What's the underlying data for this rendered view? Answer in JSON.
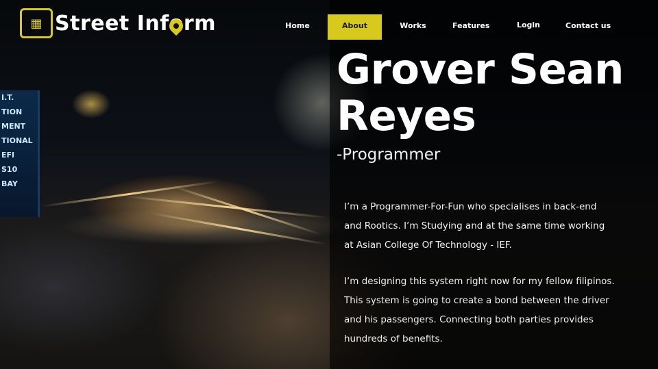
{
  "brand": {
    "name": "Street Inform",
    "accent": "#d8c91d",
    "logo_icon": "map-icon",
    "pin_icon": "location-pin-icon"
  },
  "nav": {
    "items": [
      {
        "label": "Home",
        "active": false
      },
      {
        "label": "About",
        "active": true
      },
      {
        "label": "Works",
        "active": false
      },
      {
        "label": "Features",
        "active": false
      },
      {
        "label": "Login",
        "active": false
      },
      {
        "label": "Contact us",
        "active": false
      }
    ]
  },
  "profile": {
    "name_line1": "Grover Sean",
    "name_line2": "Reyes",
    "role": "-Programmer"
  },
  "about": {
    "paragraph1": [
      "I’m a Programmer-For-Fun who specialises in back-end",
      "and Rootics. I’m Studying and at the same time working",
      " at Asian College Of Technology - IEF."
    ],
    "paragraph2": [
      "I’m designing this system right now for my fellow filipinos.",
      "This system is going to create a bond between the driver",
      "and his passengers. Connecting both parties provides",
      "hundreds of benefits."
    ]
  },
  "background_sign": [
    "I.T.",
    "TION",
    "MENT",
    "TIONAL",
    "EFI",
    "",
    "S10",
    "BAY"
  ]
}
